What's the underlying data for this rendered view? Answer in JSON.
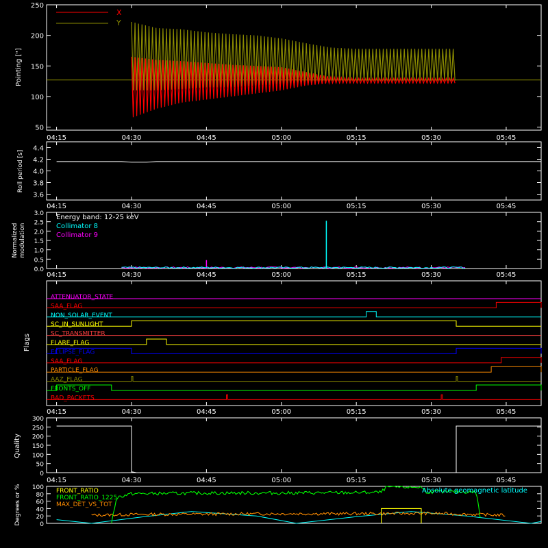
{
  "colors": {
    "background": "#000000",
    "axis": "#ffffff",
    "red": "#ff0000",
    "olive": "#8a8a00",
    "cyan": "#00ffff",
    "magenta": "#ff00ff",
    "yellow": "#ffff00",
    "green": "#00ff00",
    "orange": "#ff8c00",
    "blue": "#0000ff",
    "white": "#ffffff"
  },
  "chart_data": [
    {
      "type": "line",
      "name": "pointing",
      "ylabel": "Pointing [\"]",
      "ylim": [
        45,
        250
      ],
      "yticks": [
        50,
        100,
        150,
        200,
        250
      ],
      "xlim": [
        "04:15",
        "05:52"
      ],
      "xticks": [
        "04:15",
        "04:30",
        "04:45",
        "05:00",
        "05:15",
        "05:30",
        "05:45"
      ],
      "legend": "top-left",
      "series": [
        {
          "name": "X",
          "color": "#ff0000",
          "desc": "oscillating envelope",
          "x": [
            "04:30",
            "04:35",
            "04:40",
            "04:45",
            "04:50",
            "04:55",
            "05:00",
            "05:05",
            "05:10",
            "05:15",
            "05:20",
            "05:25",
            "05:30",
            "05:35"
          ],
          "lower": [
            65,
            80,
            90,
            95,
            100,
            105,
            110,
            118,
            122,
            122,
            122,
            122,
            122,
            122
          ],
          "upper": [
            165,
            160,
            158,
            155,
            152,
            150,
            148,
            140,
            132,
            130,
            130,
            130,
            130,
            130
          ]
        },
        {
          "name": "Y",
          "color": "#8a8a00",
          "desc": "oscillating envelope",
          "x": [
            "04:30",
            "04:35",
            "04:40",
            "04:45",
            "04:50",
            "04:55",
            "05:00",
            "05:05",
            "05:10",
            "05:15",
            "05:20",
            "05:25",
            "05:30",
            "05:35"
          ],
          "lower": [
            110,
            110,
            112,
            115,
            115,
            118,
            120,
            124,
            126,
            126,
            126,
            126,
            126,
            126
          ],
          "upper": [
            222,
            212,
            210,
            205,
            202,
            200,
            195,
            187,
            180,
            178,
            178,
            178,
            178,
            178
          ]
        }
      ],
      "reference_line": 127
    },
    {
      "type": "line",
      "name": "roll-period",
      "ylabel": "Roll period [s]",
      "ylim": [
        3.5,
        4.5
      ],
      "yticks": [
        3.6,
        3.8,
        4.0,
        4.2,
        4.4
      ],
      "xticks": [
        "04:15",
        "04:30",
        "04:45",
        "05:00",
        "05:15",
        "05:30",
        "05:45"
      ],
      "series": [
        {
          "name": "roll",
          "color": "#ffffff",
          "x": [
            "04:15",
            "04:28",
            "04:30",
            "04:33",
            "04:35",
            "05:52"
          ],
          "y": [
            4.16,
            4.16,
            4.15,
            4.15,
            4.16,
            4.16
          ]
        }
      ]
    },
    {
      "type": "line",
      "name": "modulation",
      "ylabel": "Normalized modulation",
      "ylim": [
        0,
        3.0
      ],
      "yticks": [
        0.0,
        0.5,
        1.0,
        1.5,
        2.0,
        2.5,
        3.0
      ],
      "xticks": [
        "04:15",
        "04:30",
        "04:45",
        "05:00",
        "05:15",
        "05:30",
        "05:45"
      ],
      "annotation": "Energy band: 12-25 keV",
      "series": [
        {
          "name": "Collimator 8",
          "color": "#00ffff",
          "baseline": 0.05,
          "spikes": [
            {
              "x": "05:09",
              "y": 2.55
            }
          ]
        },
        {
          "name": "Collimator 9",
          "color": "#ff00ff",
          "baseline": 0.05,
          "spikes": [
            {
              "x": "04:45",
              "y": 0.45
            }
          ]
        }
      ],
      "range": [
        "04:28",
        "05:37"
      ]
    },
    {
      "type": "line",
      "name": "flags",
      "ylabel": "Flags",
      "xticks": [
        "04:15",
        "04:30",
        "04:45",
        "05:00",
        "05:15",
        "05:30",
        "05:45"
      ],
      "series": [
        {
          "name": "ATTENUATOR_STATE",
          "color": "#ff00ff",
          "steps": []
        },
        {
          "name": "SAA_FLAG",
          "color": "#ff0000",
          "steps": [
            [
              "05:43",
              "05:52"
            ]
          ]
        },
        {
          "name": "NON_SOLAR_EVENT",
          "color": "#00ffff",
          "steps": [
            [
              "05:17",
              "05:19"
            ]
          ]
        },
        {
          "name": "SC_IN_SUNLIGHT",
          "color": "#ffff00",
          "steps": [
            [
              "04:30",
              "05:35"
            ]
          ]
        },
        {
          "name": "SC_TRANSMITTER",
          "color": "#ff4040",
          "steps": []
        },
        {
          "name": "FLARE_FLAG",
          "color": "#ffff00",
          "steps": [
            [
              "04:33",
              "04:37"
            ]
          ]
        },
        {
          "name": "ECLIPSE_FLAG",
          "color": "#0000ff",
          "steps": [
            [
              "04:15",
              "04:30"
            ],
            [
              "05:35",
              "05:52"
            ]
          ]
        },
        {
          "name": "SAA_FLAG",
          "color": "#ff0000",
          "steps": [
            [
              "05:44",
              "05:52"
            ]
          ]
        },
        {
          "name": "PARTICLE_FLAG",
          "color": "#ff8c00",
          "steps": [
            [
              "05:42",
              "05:52"
            ]
          ]
        },
        {
          "name": "AAZ_FLAG",
          "color": "#8a8a00",
          "steps": [
            [
              "04:30",
              "04:30"
            ],
            [
              "05:35",
              "05:35"
            ]
          ]
        },
        {
          "name": "FRONTS_OFF",
          "color": "#00ff00",
          "steps": [
            [
              "04:15",
              "04:26"
            ],
            [
              "05:39",
              "05:52"
            ]
          ]
        },
        {
          "name": "BAD_PACKETS",
          "color": "#ff0000",
          "steps": [
            [
              "04:49",
              "04:49"
            ],
            [
              "05:32",
              "05:32"
            ]
          ]
        }
      ]
    },
    {
      "type": "line",
      "name": "quality",
      "ylabel": "Quality",
      "ylim": [
        0,
        300
      ],
      "yticks": [
        0,
        50,
        100,
        150,
        200,
        250,
        300
      ],
      "xticks": [
        "04:15",
        "04:30",
        "04:45",
        "05:00",
        "05:15",
        "05:30",
        "05:45"
      ],
      "series": [
        {
          "name": "quality",
          "color": "#ffffff",
          "x": [
            "04:15",
            "04:30",
            "04:30",
            "04:31",
            "05:35",
            "05:35",
            "05:52"
          ],
          "y": [
            255,
            255,
            5,
            0,
            0,
            255,
            255
          ]
        }
      ]
    },
    {
      "type": "line",
      "name": "ratios",
      "ylabel": "Degrees or %",
      "ylim": [
        0,
        100
      ],
      "yticks": [
        0,
        20,
        40,
        60,
        80,
        100
      ],
      "series": [
        {
          "name": "FRONT_RATIO",
          "color": "#ffff00",
          "desc": "step near 40 between 05:20 and 05:28",
          "x": [
            "05:20",
            "05:20",
            "05:28",
            "05:28"
          ],
          "y": [
            0,
            40,
            40,
            0
          ]
        },
        {
          "name": "FRONT_RATIO_1225",
          "color": "#00ff00",
          "x": [
            "04:26",
            "04:27",
            "04:30",
            "04:45",
            "05:00",
            "05:15",
            "05:20",
            "05:21",
            "05:28",
            "05:29",
            "05:39",
            "05:40"
          ],
          "y": [
            0,
            70,
            80,
            82,
            82,
            83,
            84,
            98,
            98,
            85,
            85,
            0
          ]
        },
        {
          "name": "MAX_DET_VS_TOT",
          "color": "#ff8c00",
          "x": [
            "04:22",
            "04:30",
            "04:45",
            "05:00",
            "05:15",
            "05:30",
            "05:45"
          ],
          "y": [
            22,
            24,
            25,
            26,
            26,
            27,
            22
          ]
        },
        {
          "name": "Absolute geomagnetic latitude",
          "color": "#00ffff",
          "x": [
            "04:15",
            "04:22",
            "04:32",
            "04:42",
            "04:55",
            "05:03",
            "05:15",
            "05:26",
            "05:37",
            "05:50",
            "05:52"
          ],
          "y": [
            10,
            0,
            17,
            32,
            20,
            0,
            18,
            32,
            20,
            0,
            5
          ]
        }
      ]
    }
  ]
}
